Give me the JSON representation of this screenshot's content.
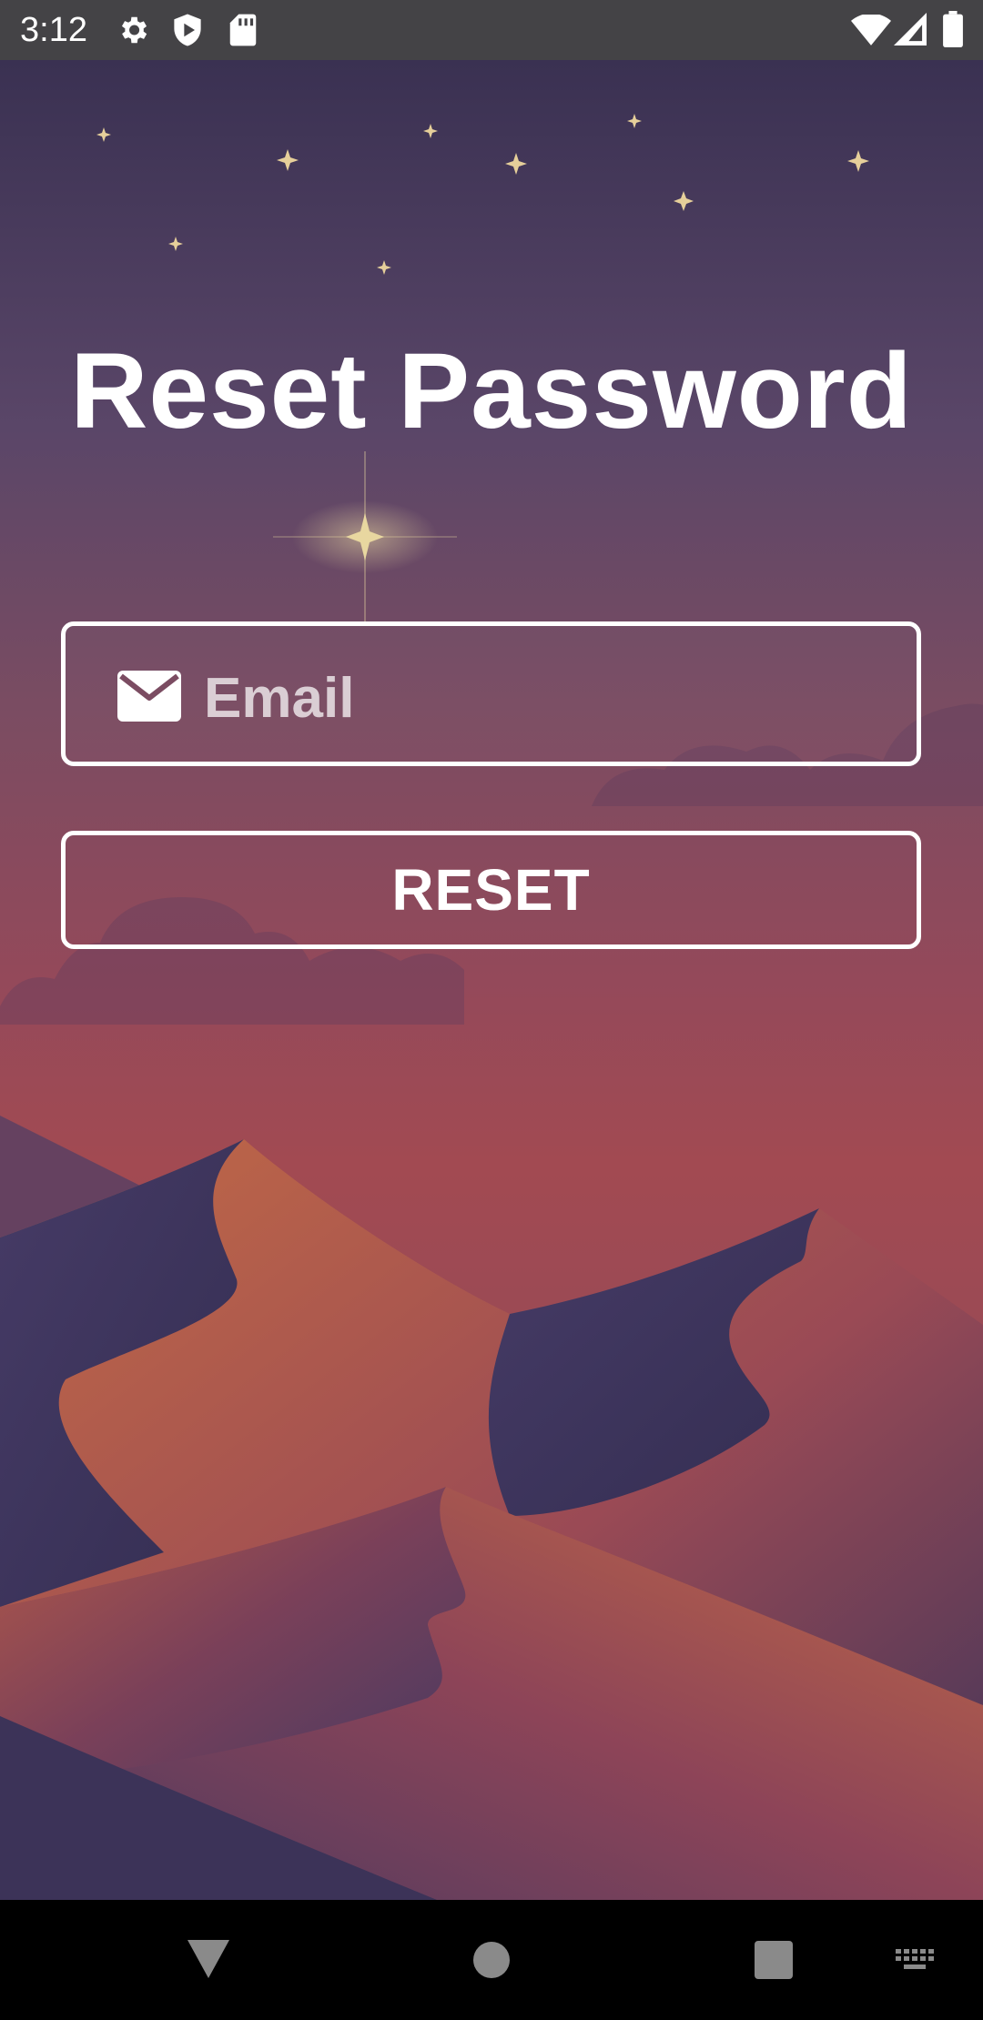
{
  "status_bar": {
    "time": "3:12",
    "left_icons": [
      "gear-icon",
      "shield-play-icon",
      "sd-card-icon"
    ],
    "right_icons": [
      "wifi-icon",
      "signal-icon",
      "battery-icon"
    ]
  },
  "page": {
    "title": "Reset Password"
  },
  "email": {
    "icon": "mail-icon",
    "placeholder": "Email",
    "value": ""
  },
  "reset_button": {
    "label": "RESET"
  },
  "nav_bar": {
    "buttons": [
      "back-icon",
      "home-icon",
      "recents-icon",
      "keyboard-icon"
    ]
  },
  "colors": {
    "status_bar": "#444346",
    "sky_top": "#3a3152",
    "sky_bottom": "#a24a52",
    "dune_dark": "#3a3157",
    "dune_light": "#c26a45",
    "accent_white": "#ffffff"
  }
}
